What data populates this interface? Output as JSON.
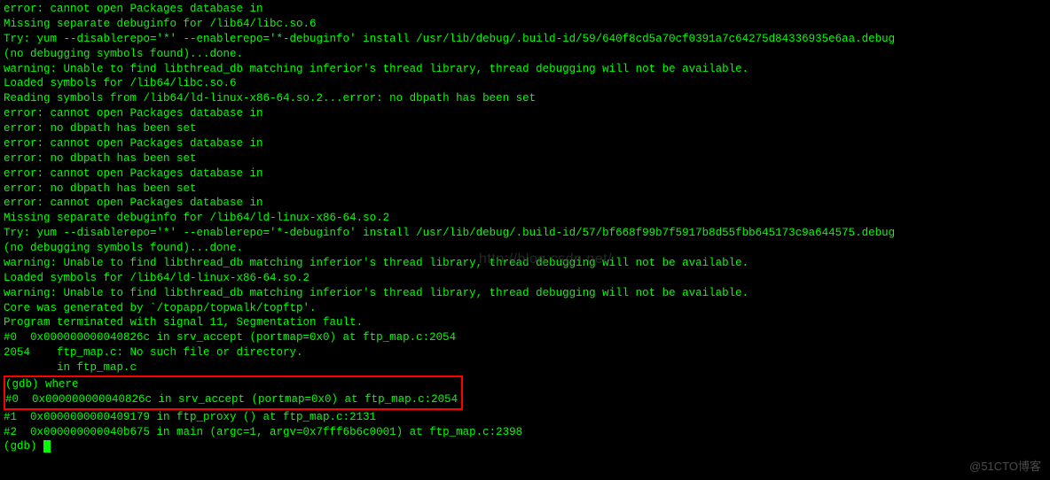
{
  "watermark": "http://blog.csdn.net/",
  "corner": "@51CTO博客",
  "lines": {
    "l0": "error: cannot open Packages database in",
    "l1": "Missing separate debuginfo for /lib64/libc.so.6",
    "l2": "Try: yum --disablerepo='*' --enablerepo='*-debuginfo' install /usr/lib/debug/.build-id/59/640f8cd5a70cf0391a7c64275d84336935e6aa.debug",
    "l3": "(no debugging symbols found)...done.",
    "l4": "",
    "l5": "warning: Unable to find libthread_db matching inferior's thread library, thread debugging will not be available.",
    "l6": "Loaded symbols for /lib64/libc.so.6",
    "l7": "Reading symbols from /lib64/ld-linux-x86-64.so.2...error: no dbpath has been set",
    "l8": "error: cannot open Packages database in",
    "l9": "error: no dbpath has been set",
    "l10": "error: cannot open Packages database in",
    "l11": "error: no dbpath has been set",
    "l12": "error: cannot open Packages database in",
    "l13": "error: no dbpath has been set",
    "l14": "error: cannot open Packages database in",
    "l15": "Missing separate debuginfo for /lib64/ld-linux-x86-64.so.2",
    "l16": "Try: yum --disablerepo='*' --enablerepo='*-debuginfo' install /usr/lib/debug/.build-id/57/bf668f99b7f5917b8d55fbb645173c9a644575.debug",
    "l17": "(no debugging symbols found)...done.",
    "l18": "",
    "l19": "warning: Unable to find libthread_db matching inferior's thread library, thread debugging will not be available.",
    "l20": "Loaded symbols for /lib64/ld-linux-x86-64.so.2",
    "l21": "",
    "l22": "warning: Unable to find libthread_db matching inferior's thread library, thread debugging will not be available.",
    "l23": "Core was generated by `/topapp/topwalk/topftp'.",
    "l24": "Program terminated with signal 11, Segmentation fault.",
    "l25": "#0  0x000000000040826c in srv_accept (portmap=0x0) at ftp_map.c:2054",
    "l26": "2054    ftp_map.c: No such file or directory.",
    "l27": "        in ftp_map.c",
    "h1": "(gdb) where",
    "h2": "#0  0x000000000040826c in srv_accept (portmap=0x0) at ftp_map.c:2054",
    "l28": "#1  0x0000000000409179 in ftp_proxy () at ftp_map.c:2131",
    "l29": "#2  0x000000000040b675 in main (argc=1, argv=0x7fff6b6c0001) at ftp_map.c:2398",
    "prompt": "(gdb) "
  }
}
